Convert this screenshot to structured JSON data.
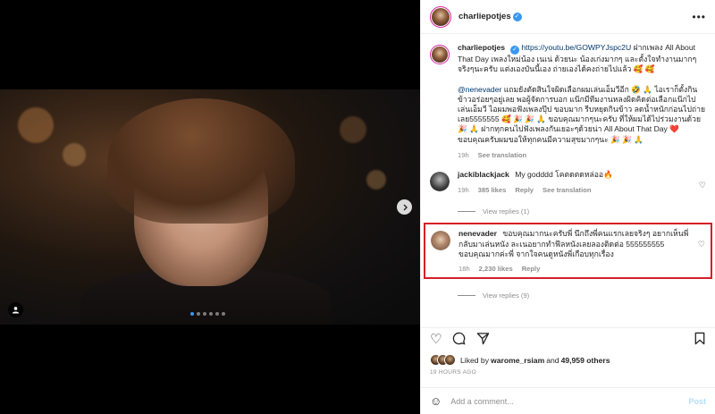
{
  "post": {
    "username": "charliepotjes",
    "more_label": "•••"
  },
  "caption": {
    "username": "charliepotjes",
    "link": "https://youtu.be/GOWPYJspc2U",
    "text1": "ฝากเพลง All About That Day เพลงใหม่น้อง เนเน่ ด้วยนะ น้องเก่งมากๆ และตั้งใจทำงานมากๆจริงๆนะครับ แต่งเองบันนี้เอง ถ่ายเองได้คงถ่ายไปแล้ว 🥰 🥰",
    "mention": "@nenevader",
    "text2": " แถมยังตัดสินใจผิดเลือกผมเล่นเอ็มวีอีก 🤣 🙏 ไอเราก็ตั้งกินข้าวอร่อยๆอยู่เลย พอผู้จัดการบอก แน๊กมีทีมงานหลงผิดคิดต่อเลือกแน๊กไปเล่นเอ็มวี ไอผมพอฟังเพลงปุ๊ป ขอบมาก รีบหยุดกินข้าว ลดน้ำหนักก่อนไปถ่ายเลย5555555 🥰 🎉 🎉 🙏 ขอบคุณมากๆนะครับ ที่ให้ผมได้ไปร่วมงานด้วย 🎉 🙏 ฝากทุกคนไปฟังเพลงกันเยอะๆด้วยน่า All About That Day ❤️ ขอบคุณครับผมขอให้ทุกคนมีความสุขมากๆนะ 🎉 🎉 🙏",
    "time": "19h",
    "translate": "See translation"
  },
  "comment1": {
    "username": "jackiblackjack",
    "text": "My godddd โคตดตดหล่ออ🔥",
    "time": "19h",
    "likes": "385 likes",
    "reply": "Reply",
    "translate": "See translation",
    "view_replies": "View replies (1)"
  },
  "comment2": {
    "username": "nenevader",
    "text": "ขอบคุณมากนะครับพี่ นึกถึงพี่คนแรกเลยจริงๆ อยากเห็นพี่กลับมาเล่นหนัง ละเนอยากทำฟีลหนังเลยลองติดต่อ 555555555 ขอบคุณมากค่ะพี่ จากใจคนดูหนังพี่เกือบทุกเรื่อง",
    "time": "18h",
    "likes": "2,230 likes",
    "reply": "Reply",
    "view_replies": "View replies (9)"
  },
  "likes": {
    "prefix": "Liked by ",
    "user": "warome_rsiam",
    "middle": " and ",
    "count": "49,959 others"
  },
  "timestamp": "19 HOURS AGO",
  "add_comment": {
    "placeholder": "Add a comment...",
    "post_label": "Post"
  },
  "carousel": {
    "total_slides": 6,
    "current_slide": 1
  }
}
